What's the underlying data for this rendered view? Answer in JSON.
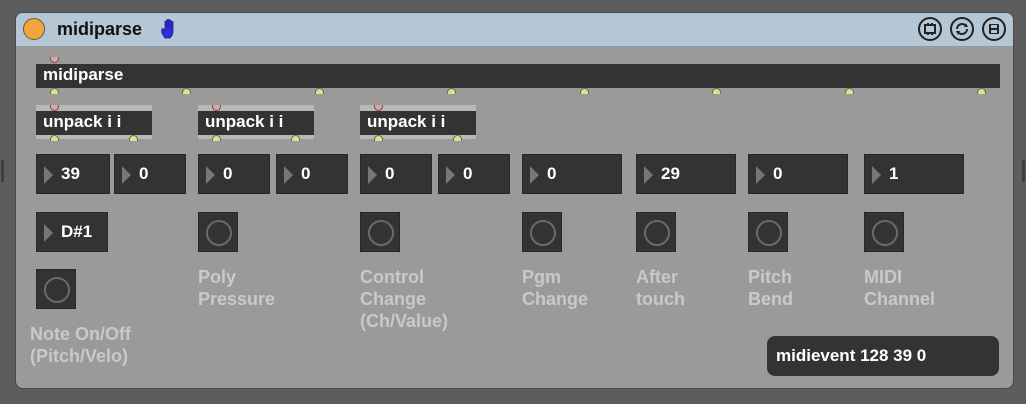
{
  "window": {
    "title": "midiparse",
    "icons": [
      "power-button",
      "hand-icon",
      "freeze-icon",
      "replace-icon",
      "save-icon"
    ]
  },
  "objects": {
    "midiparse": "midiparse",
    "unpack1": "unpack i i",
    "unpack2": "unpack i i",
    "unpack3": "unpack i i"
  },
  "numbers": {
    "note_pitch": "39",
    "note_velocity": "0",
    "poly_pitch": "0",
    "poly_pressure": "0",
    "cc_number": "0",
    "cc_value": "0",
    "program_change": "0",
    "aftertouch": "29",
    "pitch_bend": "0",
    "midi_channel": "1"
  },
  "note_name": "D#1",
  "labels": {
    "note": [
      "Note On/Off",
      "(Pitch/Velo)"
    ],
    "poly": [
      "Poly",
      "Pressure"
    ],
    "cc": [
      "Control",
      "Change",
      "(Ch/Value)"
    ],
    "pgm": [
      "Pgm",
      "Change"
    ],
    "after": [
      "After",
      "touch"
    ],
    "pitch": [
      "Pitch",
      "Bend"
    ],
    "channel": [
      "MIDI",
      "Channel"
    ]
  },
  "midievent": "midievent 128 39 0",
  "colors": {
    "background": "#5d5d5d",
    "device": "#9a9a9a",
    "titlebar": "#b5c6d4",
    "power": "#f0a640",
    "hand": "#2e2ee0",
    "object": "#333333",
    "label": "#c9c9c9"
  }
}
